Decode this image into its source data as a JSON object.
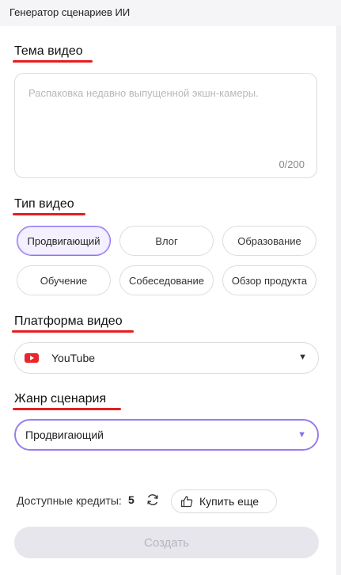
{
  "app": {
    "title": "Генератор сценариев ИИ"
  },
  "topic": {
    "title": "Тема видео",
    "placeholder": "Распаковка недавно выпущенной экшн-камеры.",
    "counter": "0/200"
  },
  "video_type": {
    "title": "Тип видео",
    "options": [
      "Продвигающий",
      "Влог",
      "Образование",
      "Обучение",
      "Собеседование",
      "Обзор продукта"
    ],
    "selected": "Продвигающий"
  },
  "platform": {
    "title": "Платформа видео",
    "value": "YouTube",
    "icon": "youtube-icon"
  },
  "genre": {
    "title": "Жанр сценария",
    "value": "Продвигающий"
  },
  "footer": {
    "credits_label": "Доступные кредиты:",
    "credits_value": "5",
    "buy_label": "Купить еще",
    "create_label": "Создать"
  },
  "colors": {
    "accent": "#8b6cf0",
    "underline": "#e61e1e",
    "youtube": "#e8262b"
  }
}
